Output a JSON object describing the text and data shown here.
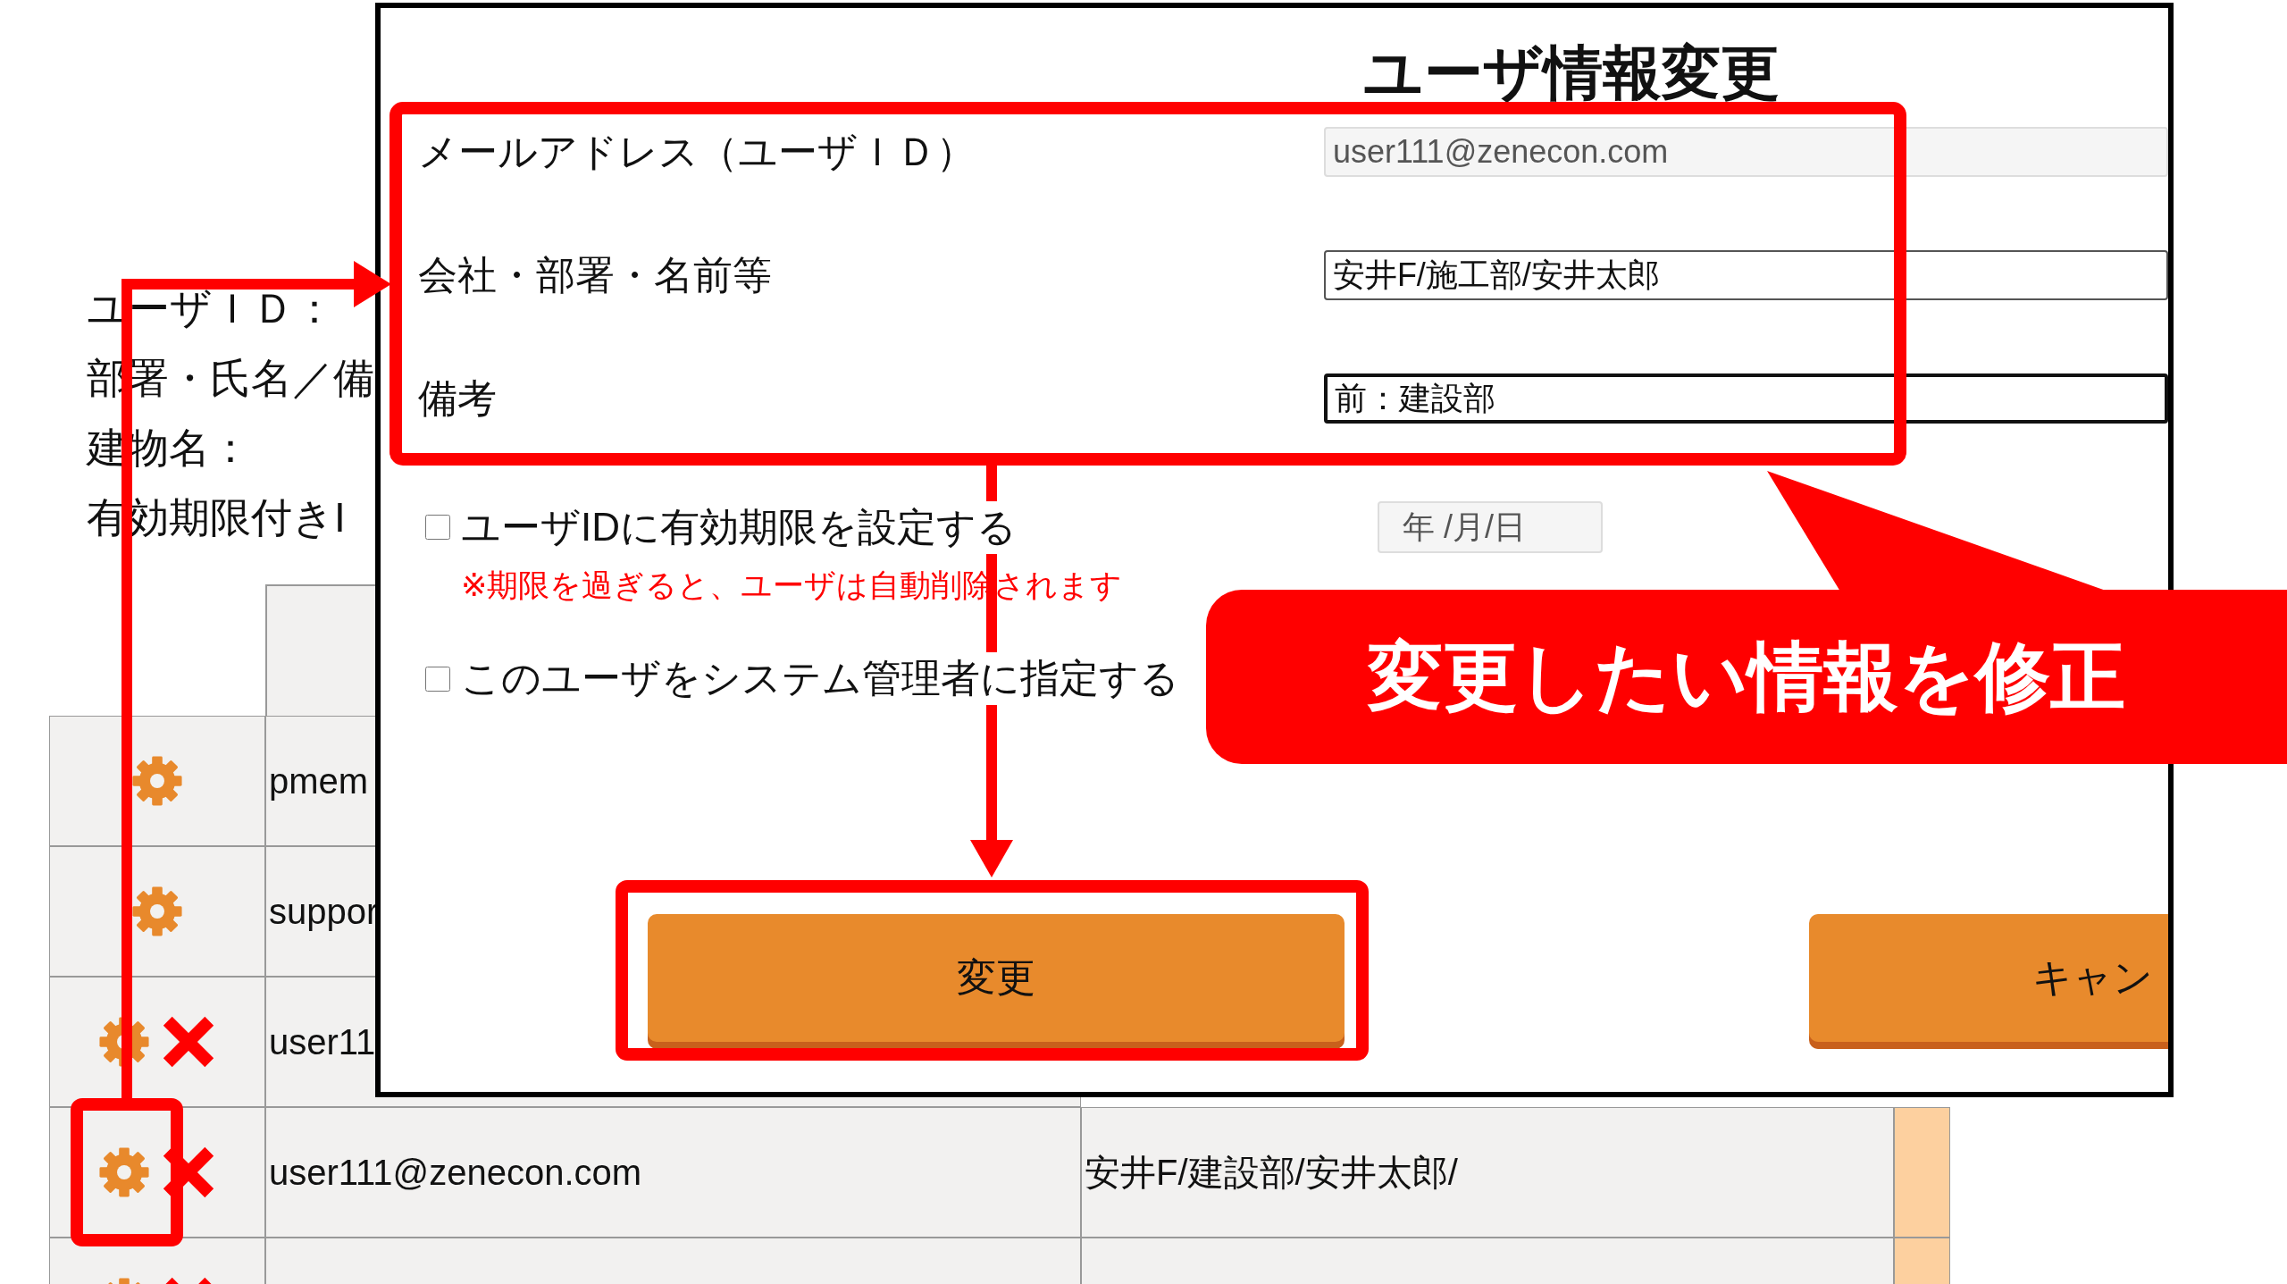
{
  "page": {
    "info_labels": [
      "ユーザＩＤ：",
      "部署・氏名／備",
      "建物名：",
      "有効期限付きI"
    ],
    "table_rows": [
      {
        "has_delete": false,
        "cells": [
          "pmem"
        ]
      },
      {
        "has_delete": false,
        "cells": [
          "suppor"
        ]
      },
      {
        "has_delete": true,
        "cells": [
          "user11"
        ]
      },
      {
        "has_delete": true,
        "cells": [
          "user111@zenecon.com",
          "安井F/建設部/安井太郎/"
        ]
      },
      {
        "has_delete": true,
        "cells": []
      }
    ]
  },
  "modal": {
    "title": "ユーザ情報変更",
    "fields": [
      {
        "label": "メールアドレス（ユーザＩＤ）",
        "value": "user111@zenecon.com",
        "kind": "readonly"
      },
      {
        "label": "会社・部署・名前等",
        "value": "安井F/施工部/安井太郎",
        "kind": "text"
      },
      {
        "label": "備考",
        "value": "前：建設部",
        "kind": "focused"
      }
    ],
    "expiry": {
      "label": "ユーザIDに有効期限を設定する",
      "checked": false,
      "note": "※期限を過ぎると、ユーザは自動削除されます",
      "date_placeholder": "年 /月/日"
    },
    "admin": {
      "label": "このユーザをシステム管理者に指定する",
      "checked": false
    },
    "buttons": [
      "変更",
      "キャン"
    ]
  },
  "callout": {
    "text": "変更したい情報を修正"
  }
}
